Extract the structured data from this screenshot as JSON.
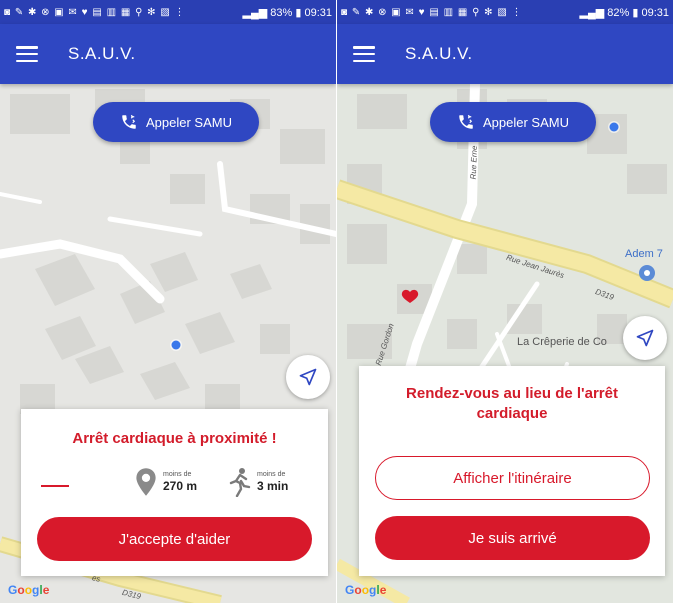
{
  "left": {
    "status": {
      "icons": "◙ ✎ ✱ ⊗ ▣ ✉ ♥ ▤ ▥ ▦ ⚲ ✻ ▧ ⋮",
      "signal": "83%",
      "time": "09:31"
    },
    "app_title": "S.A.U.V.",
    "samu_label": "Appeler SAMU",
    "card": {
      "title": "Arrêt cardiaque à proximité !",
      "distance": {
        "small": "moins de",
        "value": "270 m"
      },
      "time": {
        "small": "moins de",
        "value": "3 min"
      },
      "accept_label": "J'accepte d'aider"
    },
    "map_labels": {
      "road_bottom_1": "es",
      "road_bottom_2": "D319"
    }
  },
  "right": {
    "status": {
      "icons": "◙ ✎ ✱ ⊗ ▣ ✉ ♥ ▤ ▥ ▦ ⚲ ✻ ▧ ⋮",
      "signal": "82%",
      "time": "09:31"
    },
    "app_title": "S.A.U.V.",
    "samu_label": "Appeler SAMU",
    "card": {
      "title": "Rendez-vous au lieu de l'arrêt cardiaque",
      "itinerary_label": "Afficher l'itinéraire",
      "arrived_label": "Je suis arrivé"
    },
    "map_labels": {
      "rue_jean_jaures": "Rue Jean Jaurès",
      "d319": "D319",
      "rue_ernest": "Rue Erne",
      "rue_gordon": "Rue Gordon",
      "adem": "Adem 7",
      "creperie": "La Crêperie de Co"
    }
  },
  "google": "Google",
  "colors": {
    "appbar": "#2f47c2",
    "statusbar": "#2a3fb3",
    "accent_red": "#d8192b",
    "title_red": "#d31c2b",
    "map_bg": "#e6e6e3",
    "road_yellow": "#f5e9a4"
  }
}
